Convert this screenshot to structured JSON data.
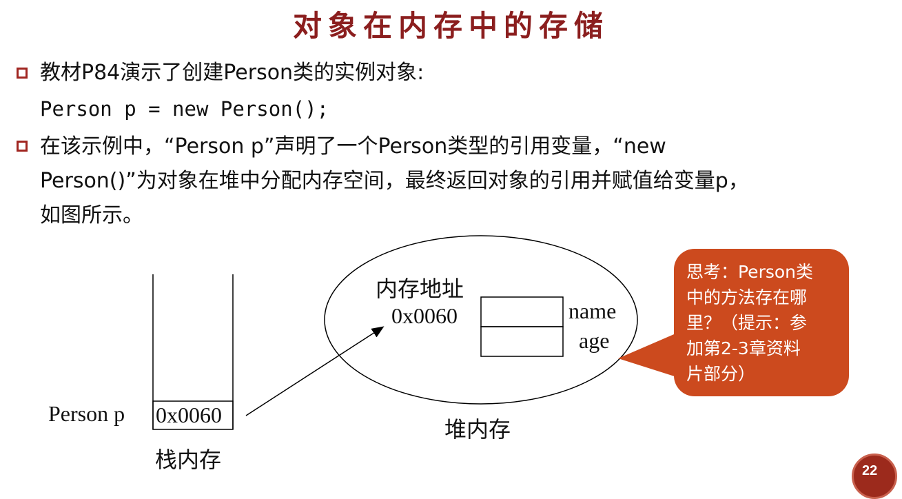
{
  "title": "对象在内存中的存储",
  "bullets": [
    {
      "lines": [
        "教材P84演示了创建Person类的实例对象:",
        "Person p = new Person();"
      ]
    },
    {
      "lines": [
        "在该示例中，“Person p”声明了一个Person类型的引用变量，“new",
        "Person()”为对象在堆中分配内存空间，最终返回对象的引用并赋值给变量p，",
        "如图所示。"
      ]
    }
  ],
  "diagram": {
    "stack": {
      "variable_label": "Person p",
      "cell_value": "0x0060",
      "caption": "栈内存"
    },
    "heap": {
      "address_label": "内存地址",
      "address_value": "0x0060",
      "fields": [
        "name",
        "age"
      ],
      "caption": "堆内存"
    }
  },
  "callout": {
    "lines": [
      "思考：Person类",
      "中的方法存在哪",
      "里？（提示：参",
      "加第2-3章资料",
      "片部分）"
    ],
    "color": "#cc4a1e"
  },
  "page_number": "22",
  "colors": {
    "title": "#8b1e1e",
    "bullet": "#a02520"
  }
}
